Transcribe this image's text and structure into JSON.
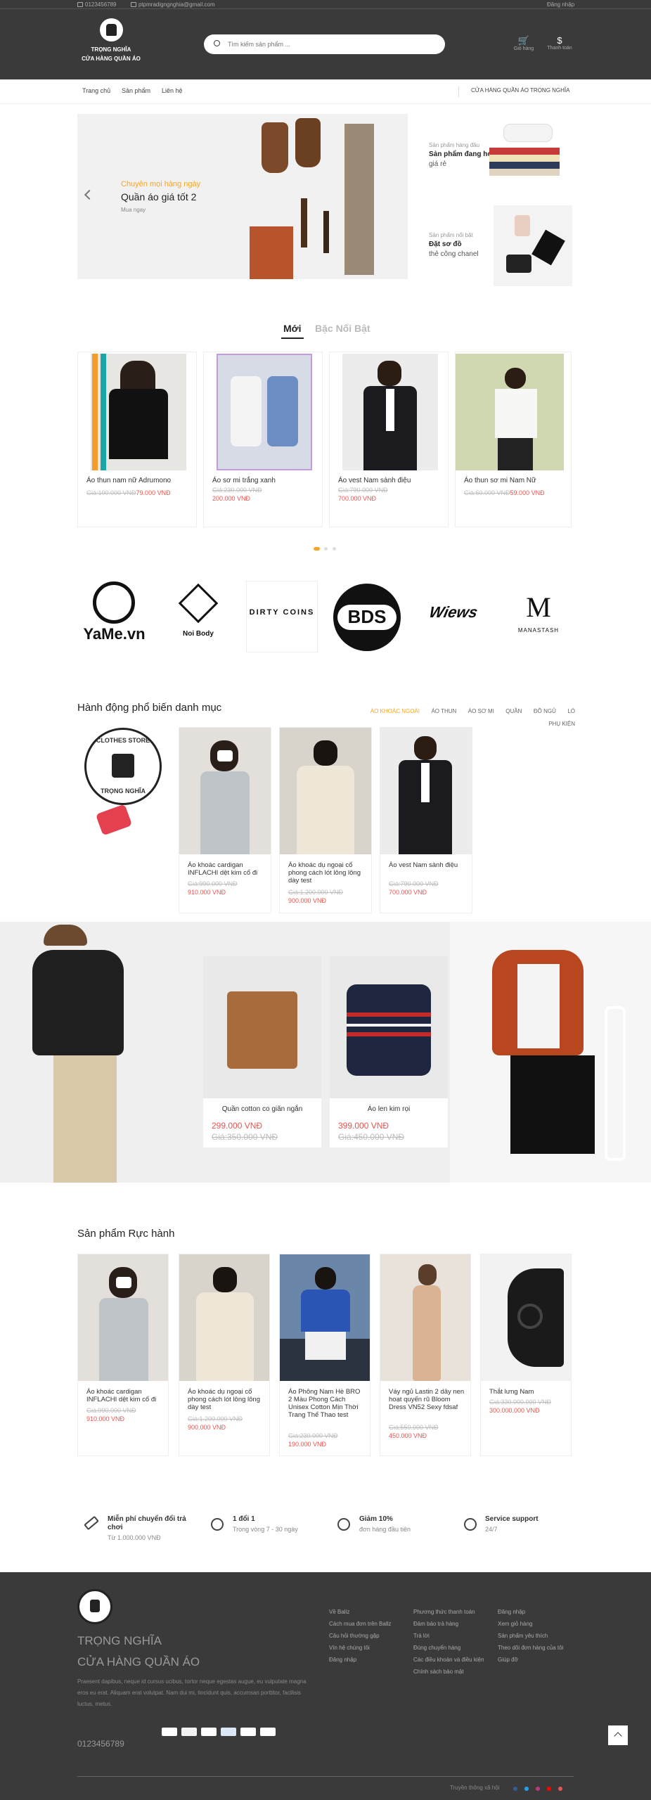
{
  "topbar": {
    "phone": "0123456789",
    "email": "ptpmradigngnghia@gmail.com",
    "login": "Đăng nhập"
  },
  "brand": {
    "name_line1": "TRỌNG NGHĨA",
    "name_line2": "CỬA HÀNG QUẦN ÁO"
  },
  "search": {
    "placeholder": "Tìm kiếm sản phẩm ..."
  },
  "header_icons": {
    "cart": "Giỏ hàng",
    "currency": "Thanh toán"
  },
  "nav": {
    "items": [
      "Trang chủ",
      "Sản phẩm",
      "Liên hệ"
    ],
    "store_label": "CỬA HÀNG QUẦN ÁO TRỌNG NGHĨA"
  },
  "hero": {
    "subtitle": "Chuyên mọi hàng ngày",
    "title": "Quần áo giá tốt 2",
    "cta": "Mua ngay"
  },
  "side_banners": [
    {
      "small": "Sản phẩm hàng đầu",
      "title": "Sản phẩm đang hot",
      "sub": "giá rẻ"
    },
    {
      "small": "Sản phẩm nổi bật",
      "title": "Đặt sơ đồ",
      "sub": "thẻ công chanel"
    }
  ],
  "tabs": {
    "new": "Mới",
    "featured": "Bặc Nổi Bật"
  },
  "new_products": [
    {
      "name": "Áo thun nam nữ Adrumono",
      "old": "Giá:100.000 VNĐ",
      "new": "79.000 VNĐ",
      "color": "#e8e6e2"
    },
    {
      "name": "Áo sơ mi trắng xanh",
      "old": "Giá:230.000 VNĐ",
      "new": "200.000 VNĐ",
      "color": "#d6dbe6"
    },
    {
      "name": "Áo vest Nam sành điệu",
      "old": "Giá:790.000 VNĐ",
      "new": "700.000 VNĐ",
      "color": "#ececec"
    },
    {
      "name": "Áo thun sơ mi Nam Nữ",
      "old": "Giá:60.000 VNĐ",
      "new": "59.000 VNĐ",
      "color": "#cfd8b0"
    }
  ],
  "brands": [
    "YaMe.vn",
    "Noi Body",
    "DIRTY COINS",
    "BDS",
    "Wiews",
    "MANASTASH"
  ],
  "category_section": {
    "title": "Hành động phổ biến danh mục",
    "tabs": [
      "ÁO KHOÁC NGOÀI",
      "ÁO THUN",
      "ÁO SƠ MI",
      "QUẦN",
      "ĐỒ NGỦ",
      "LÓ",
      "PHỤ KIỆN"
    ],
    "store_badge_top": "CLOTHES STORE",
    "store_badge_bottom": "TRỌNG NGHĨA",
    "products": [
      {
        "name": "Áo khoác cardigan INFLACHI dệt kim cổ đi",
        "old": "Giá:990.000 VNĐ",
        "new": "910.000 VNĐ",
        "color": "#e3dfda"
      },
      {
        "name": "Áo khoác dụ ngoại cổ phong cách lót lông lông dày test",
        "old": "Giá:1.200.000 VNĐ",
        "new": "900.000 VNĐ",
        "color": "#d8d3cb"
      },
      {
        "name": "Áo vest Nam sành điệu",
        "old": "Giá:790.000 VNĐ",
        "new": "700.000 VNĐ",
        "color": "#ececec"
      }
    ]
  },
  "promo": [
    {
      "name": "Quần cotton co giãn ngắn",
      "price": "299.000 VNĐ",
      "old": "Giá:350.000 VNĐ"
    },
    {
      "name": "Áo len kim rọi",
      "price": "399.000 VNĐ",
      "old": "Giá:450.000 VNĐ"
    }
  ],
  "hot_section": {
    "title": "Sản phẩm Rực hành",
    "products": [
      {
        "name": "Áo khoác cardigan INFLACHI dệt kim cổ đi",
        "old": "Giá:990.000 VNĐ",
        "new": "910.000 VNĐ",
        "color": "#e3dfda"
      },
      {
        "name": "Áo khoác dụ ngoại cổ phong cách lót lông lông dày test",
        "old": "Giá:1.200.000 VNĐ",
        "new": "900.000 VNĐ",
        "color": "#d8d3cb"
      },
      {
        "name": "Áo Phông Nam Hè BRO 2 Màu Phong Cách Unisex Cotton Mịn Thời Trang Thể Thao test",
        "old": "Giá:230.000 VNĐ",
        "new": "190.000 VNĐ",
        "color": "#6a86a8"
      },
      {
        "name": "Váy ngủ Lastin 2 dây nen hoạt quyến rũ Bloom Dress VN52 Sexy fdsaf",
        "old": "Giá:550.000 VNĐ",
        "new": "450.000 VNĐ",
        "color": "#e8e2da"
      },
      {
        "name": "Thắt lưng Nam",
        "old": "Giá:330.000.000 VNĐ",
        "new": "300.000.000 VNĐ",
        "color": "#f2f2f2"
      }
    ]
  },
  "features": [
    {
      "title": "Miễn phí chuyển đổi trả chơi",
      "sub": "Từ 1.000.000 VNĐ"
    },
    {
      "title": "1 đổi 1",
      "sub": "Trong vòng 7 - 30 ngày"
    },
    {
      "title": "Giảm 10%",
      "sub": "đơn hàng đầu tiên"
    },
    {
      "title": "Service support",
      "sub": "24/7"
    }
  ],
  "footer": {
    "name1": "TRỌNG NGHĨA",
    "name2": "CỬA HÀNG QUẦN ÁO",
    "desc": "Praesent dapibus, neque id cursus ucibus, tortor neque egestas augue, eu vulputate magna eros eu erat. Aliquam erat volutpat. Nam dui mi, tincidunt quis, accumsan porttitor, facilisis luctus, metus.",
    "phone": "0123456789",
    "col1": [
      "Về Baliz",
      "Cách mua đơn trên Ballz",
      "Câu hỏi thường gặp",
      "Vín hệ chúng tôi",
      "Đăng nhập"
    ],
    "col2": [
      "Phương thức thanh toán",
      "Đảm bảo trả hàng",
      "Trả lời",
      "Đúng chuyển hàng",
      "Các điều khoản và điều kiện",
      "Chính sách bảo mật"
    ],
    "col3": [
      "Đăng nhập",
      "Xem giỏ hàng",
      "Sản phẩm yêu thích",
      "Theo dõi đơn hàng của tôi",
      "Giúp đỡ"
    ],
    "follow": "Truyền thông xã hội",
    "social_colors": [
      "#3b5998",
      "#1da1f2",
      "#c13584",
      "#ff0000",
      "#e7554f"
    ],
    "pay": [
      "VISA",
      "MC",
      "PP",
      "AMEX",
      "DC",
      "Pay"
    ]
  },
  "colors": {
    "accent": "#f5a623",
    "price": "#e7554f",
    "dark": "#3a3a3a"
  }
}
